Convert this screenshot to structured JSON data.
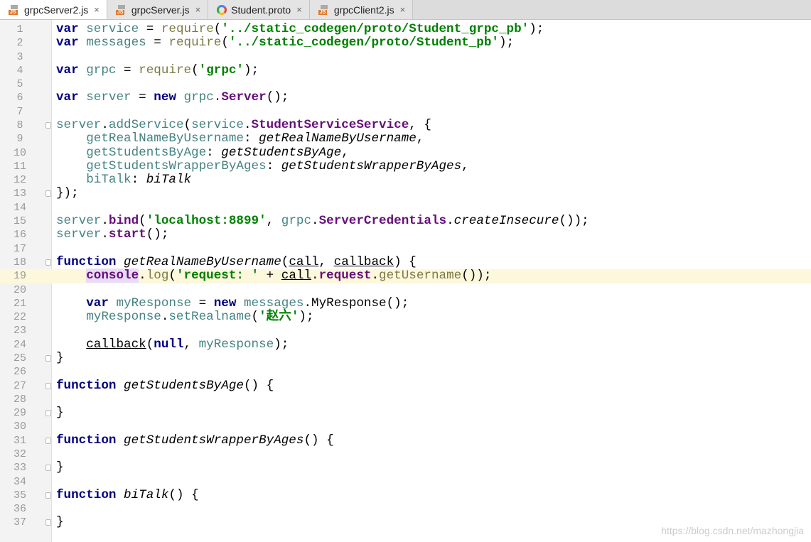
{
  "tabs": [
    {
      "label": "grpcServer2.js",
      "icon": "js-file-icon",
      "active": true
    },
    {
      "label": "grpcServer.js",
      "icon": "js-file-icon"
    },
    {
      "label": "Student.proto",
      "icon": "proto-file-icon"
    },
    {
      "label": "grpcClient2.js",
      "icon": "js-file-icon"
    }
  ],
  "close_glyph": "×",
  "current_line": 19,
  "fold_lines": [
    8,
    13,
    18,
    25,
    27,
    29,
    31,
    33,
    35,
    37
  ],
  "lines": [
    [
      [
        "var",
        "k"
      ],
      [
        " service",
        "v"
      ],
      [
        " = "
      ],
      [
        "require",
        "f"
      ],
      [
        "("
      ],
      [
        "'../static_codegen/proto/Student_grpc_pb'",
        "s"
      ],
      [
        ");"
      ]
    ],
    [
      [
        "var",
        "k"
      ],
      [
        " messages",
        "v"
      ],
      [
        " = "
      ],
      [
        "require",
        "f"
      ],
      [
        "("
      ],
      [
        "'../static_codegen/proto/Student_pb'",
        "s"
      ],
      [
        ");"
      ]
    ],
    [],
    [
      [
        "var",
        "k"
      ],
      [
        " grpc",
        "v"
      ],
      [
        " = "
      ],
      [
        "require",
        "f"
      ],
      [
        "("
      ],
      [
        "'grpc'",
        "s"
      ],
      [
        ");"
      ]
    ],
    [],
    [
      [
        "var",
        "k"
      ],
      [
        " server",
        "v"
      ],
      [
        " = "
      ],
      [
        "new",
        "k"
      ],
      [
        " grpc",
        "v"
      ],
      [
        "."
      ],
      [
        "Server",
        "p"
      ],
      [
        "();"
      ]
    ],
    [],
    [
      [
        "server",
        "v"
      ],
      [
        "."
      ],
      [
        "addService",
        "v"
      ],
      [
        "("
      ],
      [
        "service",
        "v"
      ],
      [
        "."
      ],
      [
        "StudentServiceService",
        "p"
      ],
      [
        ", {"
      ]
    ],
    [
      [
        "    getRealNameByUsername",
        "v"
      ],
      [
        ": "
      ],
      [
        "getRealNameByUsername",
        "i"
      ],
      [
        ","
      ]
    ],
    [
      [
        "    getStudentsByAge",
        "v"
      ],
      [
        ": "
      ],
      [
        "getStudentsByAge",
        "i"
      ],
      [
        ","
      ]
    ],
    [
      [
        "    getStudentsWrapperByAges",
        "v"
      ],
      [
        ": "
      ],
      [
        "getStudentsWrapperByAges",
        "i"
      ],
      [
        ","
      ]
    ],
    [
      [
        "    biTalk",
        "v"
      ],
      [
        ": "
      ],
      [
        "biTalk",
        "i"
      ]
    ],
    [
      [
        "});"
      ]
    ],
    [],
    [
      [
        "server",
        "v"
      ],
      [
        "."
      ],
      [
        "bind",
        "p"
      ],
      [
        "("
      ],
      [
        "'localhost:8899'",
        "s"
      ],
      [
        ", "
      ],
      [
        "grpc",
        "v"
      ],
      [
        "."
      ],
      [
        "ServerCredentials",
        "p"
      ],
      [
        "."
      ],
      [
        "createInsecure",
        "i"
      ],
      [
        "());"
      ]
    ],
    [
      [
        "server",
        "v"
      ],
      [
        "."
      ],
      [
        "start",
        "p"
      ],
      [
        "();"
      ]
    ],
    [],
    [
      [
        "function",
        "k"
      ],
      [
        " "
      ],
      [
        "getRealNameByUsername",
        "i"
      ],
      [
        "("
      ],
      [
        "call",
        "u"
      ],
      [
        ", "
      ],
      [
        "callback",
        "u"
      ],
      [
        ") {"
      ]
    ],
    [
      [
        "    "
      ],
      [
        "console",
        "p hl"
      ],
      [
        "."
      ],
      [
        "log",
        "f"
      ],
      [
        "("
      ],
      [
        "'request: '",
        "s"
      ],
      [
        " + "
      ],
      [
        "call",
        "u"
      ],
      [
        "."
      ],
      [
        "request",
        "p"
      ],
      [
        "."
      ],
      [
        "getUsername",
        "f"
      ],
      [
        "());"
      ]
    ],
    [],
    [
      [
        "    "
      ],
      [
        "var",
        "k"
      ],
      [
        " myResponse",
        "v"
      ],
      [
        " = "
      ],
      [
        "new",
        "k"
      ],
      [
        " messages",
        "v"
      ],
      [
        "."
      ],
      [
        "MyResponse"
      ],
      [
        "();"
      ]
    ],
    [
      [
        "    myResponse",
        "v"
      ],
      [
        "."
      ],
      [
        "setRealname",
        "v"
      ],
      [
        "("
      ],
      [
        "'赵六'",
        "s"
      ],
      [
        ");"
      ]
    ],
    [],
    [
      [
        "    "
      ],
      [
        "callback",
        "u"
      ],
      [
        "("
      ],
      [
        "null",
        "k"
      ],
      [
        ", "
      ],
      [
        "myResponse",
        "v"
      ],
      [
        ");"
      ]
    ],
    [
      [
        "}"
      ]
    ],
    [],
    [
      [
        "function",
        "k"
      ],
      [
        " "
      ],
      [
        "getStudentsByAge",
        "i"
      ],
      [
        "() {"
      ]
    ],
    [],
    [
      [
        "}"
      ]
    ],
    [],
    [
      [
        "function",
        "k"
      ],
      [
        " "
      ],
      [
        "getStudentsWrapperByAges",
        "i"
      ],
      [
        "() {"
      ]
    ],
    [],
    [
      [
        "}"
      ]
    ],
    [],
    [
      [
        "function",
        "k"
      ],
      [
        " "
      ],
      [
        "biTalk",
        "i"
      ],
      [
        "() {"
      ]
    ],
    [],
    [
      [
        "}"
      ]
    ]
  ],
  "watermark": "https://blog.csdn.net/mazhongjia"
}
